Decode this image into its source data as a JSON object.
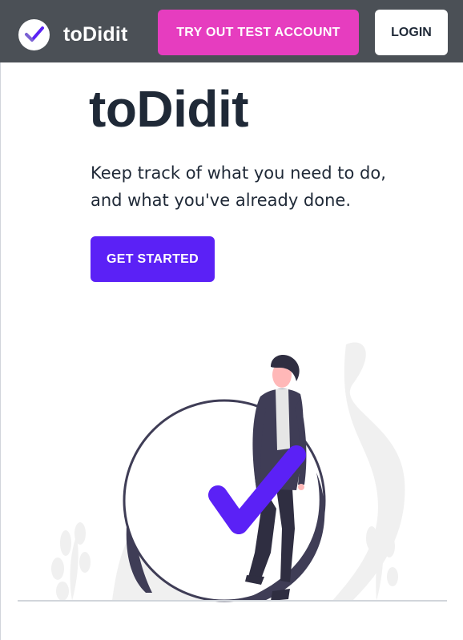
{
  "navbar": {
    "brand_name": "toDidit",
    "brand_icon": "checkmark-logo-icon",
    "try_button_label": "TRY OUT TEST ACCOUNT",
    "login_button_label": "LOGIN"
  },
  "hero": {
    "title": "toDidit",
    "subtitle_line1": "Keep track of what you need to do,",
    "subtitle_line2": "and what you've already done.",
    "cta_label": "GET STARTED"
  },
  "illustration": {
    "name": "person-with-checkmark-illustration"
  },
  "colors": {
    "navbar_bg": "#4b5056",
    "try_button": "#e63dbf",
    "primary": "#5b21f6",
    "title_text": "#1f2937"
  }
}
